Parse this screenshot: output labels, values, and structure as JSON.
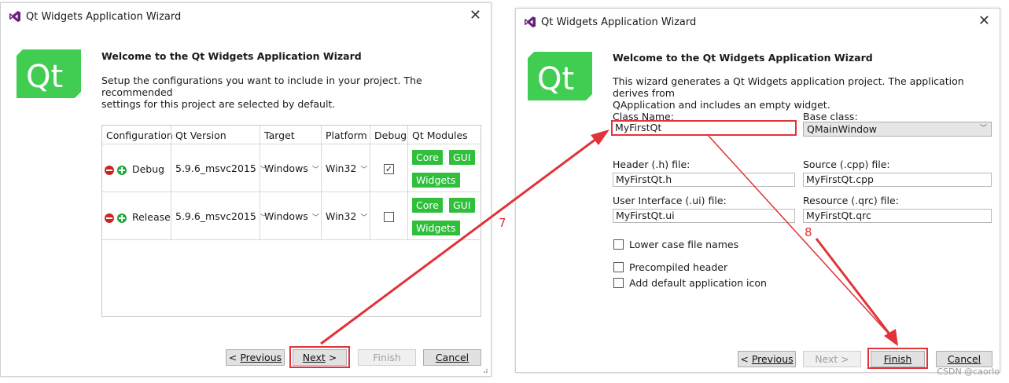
{
  "colors": {
    "qt_green": "#41cd52",
    "annotation_red": "#e0333a",
    "module_green": "#2fbf3b"
  },
  "left": {
    "title": "Qt Widgets Application Wizard",
    "heading": "Welcome to the Qt Widgets Application Wizard",
    "desc_line1": "Setup the configurations you want to include in your project. The recommended",
    "desc_line2": "settings for this project are selected by default.",
    "table": {
      "headers": [
        "Configuration",
        "Qt Version",
        "Target",
        "Platform",
        "Debug",
        "Qt Modules"
      ],
      "rows": [
        {
          "config": "Debug",
          "qt_version": "5.9.6_msvc2015",
          "target": "Windows",
          "platform": "Win32",
          "debug_checked": true,
          "modules": [
            "Core",
            "GUI",
            "Widgets"
          ]
        },
        {
          "config": "Release",
          "qt_version": "5.9.6_msvc2015",
          "target": "Windows",
          "platform": "Win32",
          "debug_checked": false,
          "modules": [
            "Core",
            "GUI",
            "Widgets"
          ]
        }
      ]
    },
    "buttons": {
      "previous": "Previous",
      "next": "Next",
      "finish": "Finish",
      "cancel": "Cancel"
    },
    "icons": {
      "app": "visual-studio-icon",
      "close": "close-icon",
      "remove": "remove-icon",
      "add": "add-icon"
    }
  },
  "right": {
    "title": "Qt Widgets Application Wizard",
    "heading": "Welcome to the Qt Widgets Application Wizard",
    "desc_line1": "This wizard generates a Qt Widgets application project. The application derives from",
    "desc_line2": "QApplication and includes an empty widget.",
    "class_name_label": "Class Name:",
    "class_name_value": "MyFirstQt",
    "base_class_label": "Base class:",
    "base_class_value": "QMainWindow",
    "header_label": "Header (.h) file:",
    "header_value": "MyFirstQt.h",
    "source_label": "Source (.cpp) file:",
    "source_value": "MyFirstQt.cpp",
    "ui_label": "User Interface (.ui) file:",
    "ui_value": "MyFirstQt.ui",
    "resource_label": "Resource (.qrc) file:",
    "resource_value": "MyFirstQt.qrc",
    "lower_case_label": "Lower case file names",
    "precompiled_label": "Precompiled header",
    "app_icon_label": "Add default application icon",
    "buttons": {
      "previous": "Previous",
      "next": "Next",
      "finish": "Finish",
      "cancel": "Cancel"
    }
  },
  "annotations": {
    "step7": "7",
    "step8": "8"
  },
  "watermark": "CSDN @caorlo"
}
